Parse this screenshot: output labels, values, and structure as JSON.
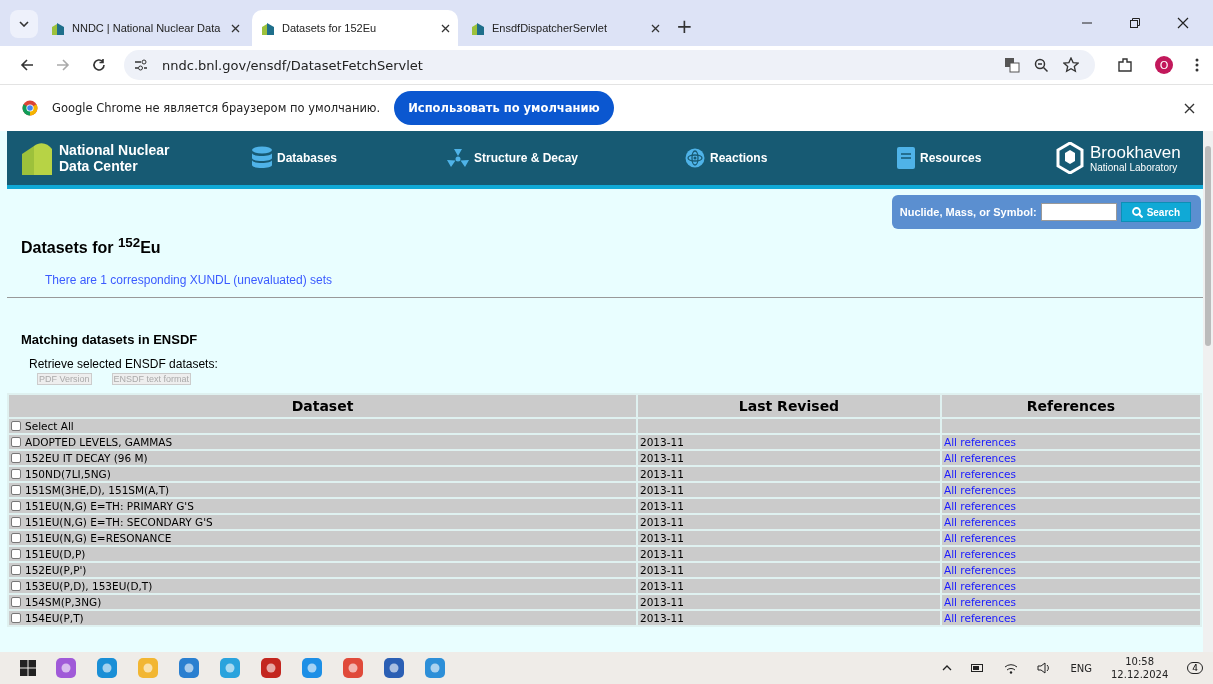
{
  "browser": {
    "tabs": [
      {
        "title": "NNDC | National Nuclear Data",
        "selected": false
      },
      {
        "title": "Datasets for 152Eu",
        "selected": true
      },
      {
        "title": "EnsdfDispatcherServlet",
        "selected": false
      }
    ],
    "new_tab": "+",
    "url": "nndc.bnl.gov/ensdf/DatasetFetchServlet",
    "profile": "O",
    "infobar": {
      "message": "Google Chrome не является браузером по умолчанию.",
      "button": "Использовать по умолчанию"
    }
  },
  "site_nav": {
    "logo": [
      "National Nuclear",
      "Data Center"
    ],
    "items": [
      "Databases",
      "Structure & Decay",
      "Reactions",
      "Resources"
    ],
    "partner": [
      "Brookhaven",
      "National Laboratory"
    ]
  },
  "search": {
    "label": "Nuclide, Mass, or Symbol:",
    "button": "Search"
  },
  "title": "Datasets for $^{152}$Eu",
  "xundl_link": "There are 1 corresponding XUNDL (unevaluated) sets",
  "section": "Matching datasets in ENSDF",
  "retrieve_label": "Retrieve selected ENSDF datasets:",
  "retrieve_buttons": [
    {
      "label": "PDF Version",
      "disabled": true
    },
    {
      "label": "ENSDF text format",
      "disabled": true
    }
  ],
  "table": {
    "columns": [
      "Dataset",
      "Last Revised",
      "References"
    ],
    "select_all": {
      "label": "Select All",
      "checked": false
    },
    "rows": [
      {
        "dataset": "ADOPTED LEVELS, GAMMAS",
        "revised": "2013-11",
        "refs": "All references",
        "checked": false
      },
      {
        "dataset": "152EU IT DECAY (96 M)",
        "revised": "2013-11",
        "refs": "All references",
        "checked": false
      },
      {
        "dataset": "150ND(7LI,5NG)",
        "revised": "2013-11",
        "refs": "All references",
        "checked": false
      },
      {
        "dataset": "151SM(3HE,D), 151SM(A,T)",
        "revised": "2013-11",
        "refs": "All references",
        "checked": false
      },
      {
        "dataset": "151EU(N,G) E=TH: PRIMARY G'S",
        "revised": "2013-11",
        "refs": "All references",
        "checked": false
      },
      {
        "dataset": "151EU(N,G) E=TH: SECONDARY G'S",
        "revised": "2013-11",
        "refs": "All references",
        "checked": false
      },
      {
        "dataset": "151EU(N,G) E=RESONANCE",
        "revised": "2013-11",
        "refs": "All references",
        "checked": false
      },
      {
        "dataset": "151EU(D,P)",
        "revised": "2013-11",
        "refs": "All references",
        "checked": false
      },
      {
        "dataset": "152EU(P,P')",
        "revised": "2013-11",
        "refs": "All references",
        "checked": false
      },
      {
        "dataset": "153EU(P,D), 153EU(D,T)",
        "revised": "2013-11",
        "refs": "All references",
        "checked": false
      },
      {
        "dataset": "154SM(P,3NG)",
        "revised": "2013-11",
        "refs": "All references",
        "checked": false
      },
      {
        "dataset": "154EU(P,T)",
        "revised": "2013-11",
        "refs": "All references",
        "checked": false
      }
    ]
  },
  "taskbar": {
    "language": "ENG",
    "time": "10:58",
    "date": "12.12.2024",
    "notifications": "4"
  }
}
